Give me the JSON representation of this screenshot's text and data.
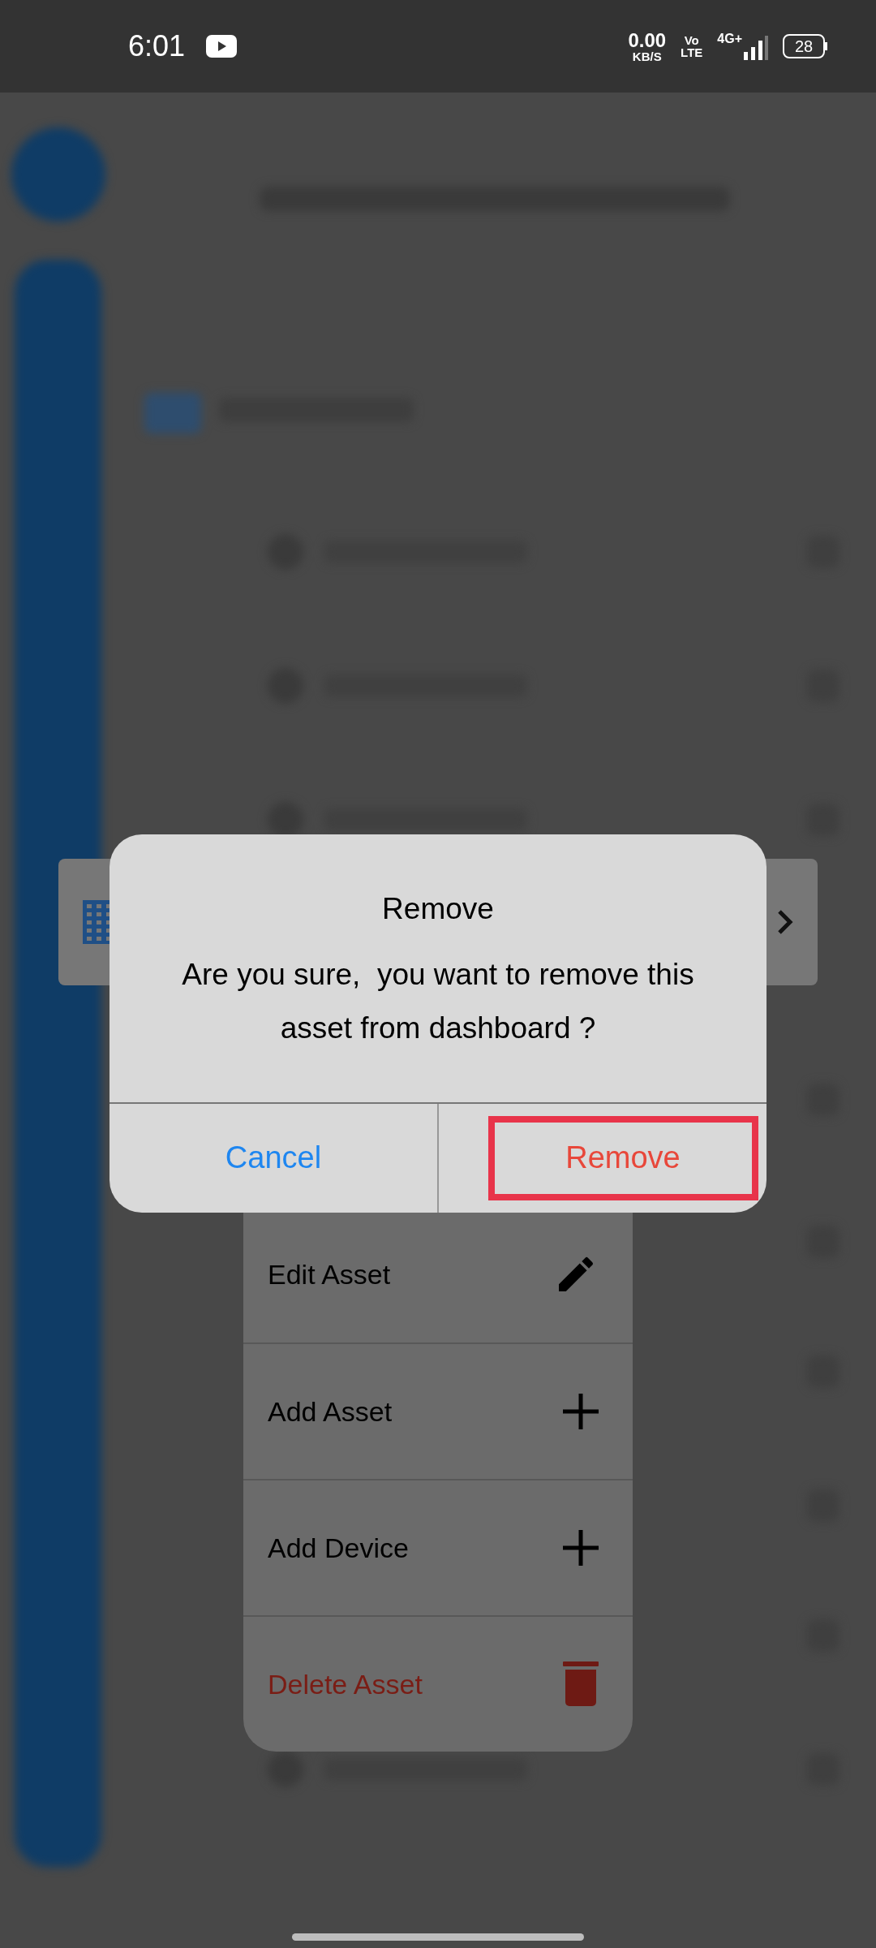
{
  "status_bar": {
    "time": "6:01",
    "net_speed": "0.00",
    "net_unit": "KB/S",
    "volte_top": "Vo",
    "volte_bottom": "LTE",
    "network": "4G+",
    "battery": "28"
  },
  "dialog": {
    "title": "Remove",
    "message": "Are you sure,  you want to remove this asset from dashboard ?",
    "buttons": [
      {
        "label": "Cancel",
        "kind": "cancel",
        "highlighted": false
      },
      {
        "label": "Remove",
        "kind": "destructive",
        "highlighted": true
      }
    ]
  },
  "menu": {
    "items": [
      {
        "label": "Edit Asset",
        "kind": "edit",
        "destructive": false
      },
      {
        "label": "Add Asset",
        "kind": "add",
        "destructive": false
      },
      {
        "label": "Add Device",
        "kind": "add",
        "destructive": false
      },
      {
        "label": "Delete Asset",
        "kind": "delete",
        "destructive": true
      }
    ]
  }
}
